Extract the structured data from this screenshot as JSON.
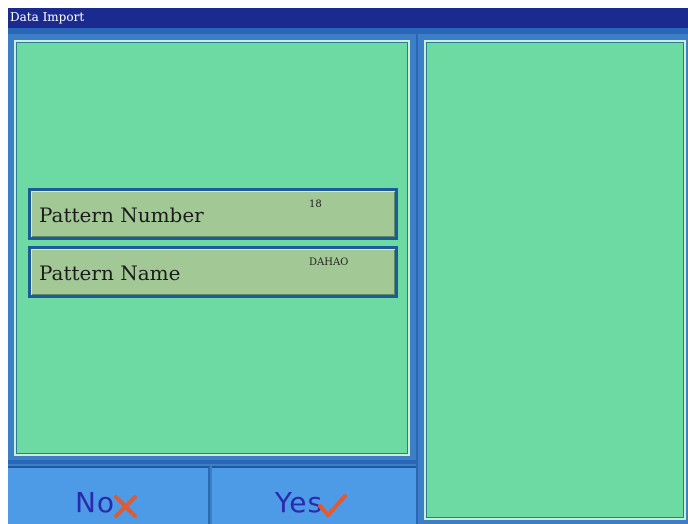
{
  "window": {
    "title": "Data Import"
  },
  "fields": {
    "pattern_number": {
      "label": "Pattern Number",
      "value": "18"
    },
    "pattern_name": {
      "label": "Pattern Name",
      "value": "DAHAO"
    }
  },
  "buttons": {
    "no_label": "No",
    "yes_label": "Yes"
  },
  "icons": {
    "no": "x-mark-icon",
    "yes": "check-mark-icon"
  },
  "colors": {
    "title_bar": "#1b2a8e",
    "panel_green": "#6ddaa4",
    "field_bg": "#a2c896",
    "button_blue": "#4d9ae6",
    "button_text": "#2a2ab0",
    "icon_orange": "#e8582a"
  }
}
